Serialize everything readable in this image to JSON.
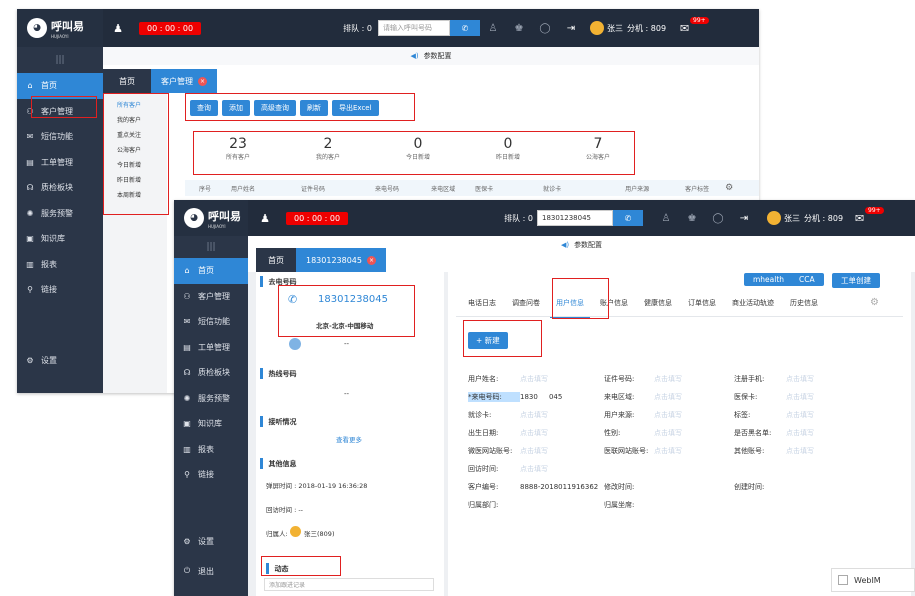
{
  "app": {
    "logo_text": "呼叫易",
    "logo_sub": "HUJIAOYI"
  },
  "back": {
    "timer": "00 : 00 : 00",
    "queue_label": "排队 : 0",
    "queue_placeholder": "请输入呼叫号码",
    "user": "张三",
    "extension": "分机 : 809",
    "mail_badge": "99+",
    "settings_bar": "参数配置",
    "nav": [
      "首页",
      "客户管理",
      "短信功能",
      "工单管理",
      "质检板块",
      "服务预警",
      "知识库",
      "报表",
      "链接"
    ],
    "settings": "设置",
    "tabs": [
      "首页",
      "客户管理"
    ],
    "subnav": [
      "所有客户",
      "我的客户",
      "重点关注",
      "公海客户",
      "今日新增",
      "昨日新增",
      "本周新增"
    ],
    "buttons": [
      "查询",
      "添加",
      "高级查询",
      "刷新",
      "导出Excel"
    ],
    "stats": [
      {
        "value": "23",
        "label": "所有客户"
      },
      {
        "value": "2",
        "label": "我的客户"
      },
      {
        "value": "0",
        "label": "今日新增"
      },
      {
        "value": "0",
        "label": "昨日新增"
      },
      {
        "value": "7",
        "label": "公海客户"
      }
    ],
    "columns": [
      "序号",
      "用户姓名",
      "证件号码",
      "来电号码",
      "来电区域",
      "医保卡",
      "就诊卡",
      "用户来源",
      "客户标签"
    ]
  },
  "front": {
    "timer": "00 : 00 : 00",
    "queue_label": "排队 : 0",
    "queue_value": "18301238045",
    "user": "张三",
    "extension": "分机 : 809",
    "mail_badge": "99+",
    "settings_bar": "参数配置",
    "nav": [
      "首页",
      "客户管理",
      "短信功能",
      "工单管理",
      "质检板块",
      "服务预警",
      "知识库",
      "报表",
      "链接"
    ],
    "settings": "设置",
    "logout": "退出",
    "tabs": [
      "首页",
      "18301238045"
    ],
    "left": {
      "outgoing_title": "去电号码",
      "phone": "18301238045",
      "location": "北京-北京-中国移动",
      "dash": "--",
      "hotline_title": "热线号码",
      "hotline_value": "--",
      "answer_title": "接听情况",
      "view_more": "查看更多",
      "other_title": "其他信息",
      "popup_time": "弹屏时间 : 2018-01-19 16:36:28",
      "callback_time": "回访时间 : --",
      "owner_label": "归属人:",
      "owner_name": "张三(809)",
      "dynamic_title": "动态",
      "add_follow": "添加跟进记录"
    },
    "right": {
      "top_buttons": [
        "mhealth",
        "CCA",
        "工单创建"
      ],
      "tabs": [
        "电话日志",
        "调查问卷",
        "用户信息",
        "账户信息",
        "健康信息",
        "订单信息",
        "商业活动轨迹",
        "历史信息"
      ],
      "new_button": "+ 新建",
      "placeholder": "点击填写",
      "fields": [
        [
          "用户姓名:",
          "证件号码:",
          "注册手机:"
        ],
        [
          "*来电号码:",
          "来电区域:",
          "医保卡:"
        ],
        [
          "就诊卡:",
          "用户来源:",
          "标签:"
        ],
        [
          "出生日期:",
          "性别:",
          "是否黑名单:"
        ],
        [
          "微医网站账号:",
          "医联网站账号:",
          "其他账号:"
        ],
        [
          "回访时间:"
        ],
        [
          "客户编号:",
          "修改时间:",
          "创建时间:"
        ],
        [
          "归属部门:",
          "归属坐席:"
        ]
      ],
      "incoming_value": "1830     045",
      "customer_id": "8888-2018011916362"
    }
  },
  "webim": "WebIM"
}
